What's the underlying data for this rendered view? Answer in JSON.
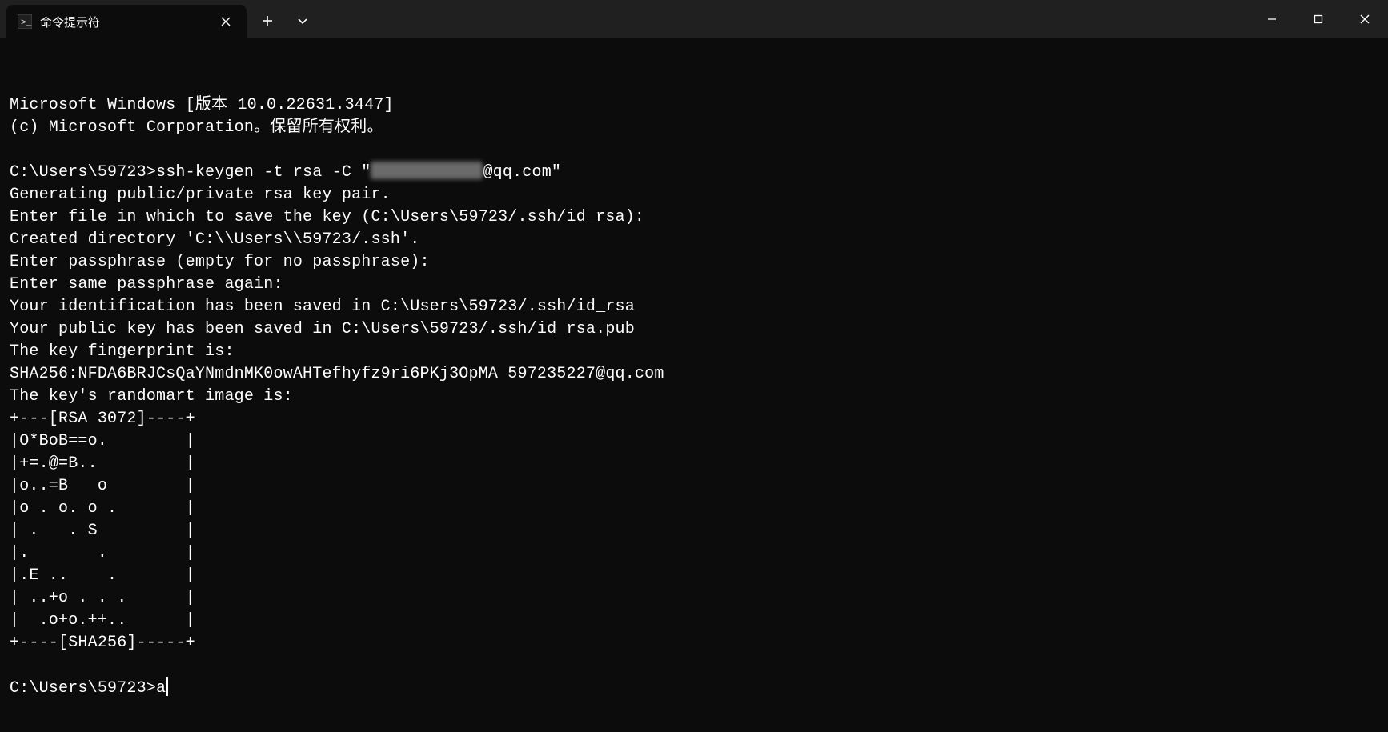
{
  "titlebar": {
    "tab_title": "命令提示符"
  },
  "terminal": {
    "lines": [
      "Microsoft Windows [版本 10.0.22631.3447]",
      "(c) Microsoft Corporation。保留所有权利。",
      "",
      "__CMD1__",
      "Generating public/private rsa key pair.",
      "Enter file in which to save the key (C:\\Users\\59723/.ssh/id_rsa):",
      "Created directory 'C:\\\\Users\\\\59723/.ssh'.",
      "Enter passphrase (empty for no passphrase):",
      "Enter same passphrase again:",
      "Your identification has been saved in C:\\Users\\59723/.ssh/id_rsa",
      "Your public key has been saved in C:\\Users\\59723/.ssh/id_rsa.pub",
      "The key fingerprint is:",
      "SHA256:NFDA6BRJCsQaYNmdnMK0owAHTefhyfz9ri6PKj3OpMA 597235227@qq.com",
      "The key's randomart image is:",
      "+---[RSA 3072]----+",
      "|O*BoB==o.        |",
      "|+=.@=B..         |",
      "|o..=B   o        |",
      "|o . o. o .       |",
      "| .   . S         |",
      "|.       .        |",
      "|.E ..    .       |",
      "| ..+o . . .      |",
      "|  .o+o.++..      |",
      "+----[SHA256]-----+",
      "",
      "__PROMPT__"
    ],
    "cmd1_prefix": "C:\\Users\\59723>ssh-keygen -t rsa -C \"",
    "cmd1_suffix": "@qq.com\"",
    "prompt_prefix": "C:\\Users\\59723>",
    "prompt_typed": "a"
  }
}
